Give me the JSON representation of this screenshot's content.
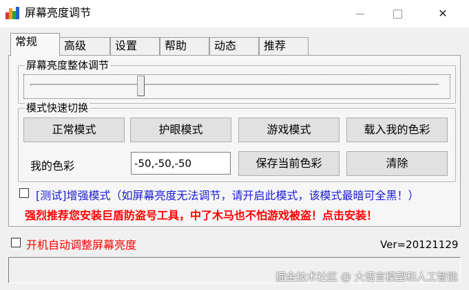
{
  "window": {
    "title": "屏幕亮度调节",
    "controls": {
      "close_glyph": "✕"
    }
  },
  "tabs": [
    {
      "label": "常规",
      "active": true
    },
    {
      "label": "高级"
    },
    {
      "label": "设置"
    },
    {
      "label": "帮助"
    },
    {
      "label": "动态"
    },
    {
      "label": "推荐"
    }
  ],
  "brightness_group": {
    "title": "屏幕亮度整体调节",
    "slider_value": 0.27
  },
  "mode_group": {
    "title": "模式快速切换",
    "buttons": [
      "正常模式",
      "护眼模式",
      "游戏模式",
      "载入我的色彩"
    ],
    "my_color_label": "我的色彩",
    "my_color_value": "-50,-50,-50",
    "save_button": "保存当前色彩",
    "clear_button": "清除"
  },
  "test_mode": {
    "label": "[测试]增强模式（如屏幕亮度无法调节，请开启此模式，该模式最暗可全黑！）",
    "checked": false
  },
  "promo": "强烈推荐您安装巨盾防盗号工具，中了木马也不怕游戏被盗！点击安装！",
  "autostart": {
    "label": "开机自动调整屏幕亮度",
    "checked": false
  },
  "version": "Ver=20121129",
  "watermark": "掘金技术社区 @ 大语言模型和人工智能",
  "colors": {
    "red_text": "#ff0000",
    "blue_text": "#1a1ad6",
    "icon_bars": [
      "#e03030",
      "#f0a020",
      "#30a040",
      "#2060d0"
    ]
  },
  "icons": {
    "app": "bar-chart-icon",
    "minimize": "minimize-icon",
    "maximize": "maximize-icon",
    "close": "close-icon"
  }
}
